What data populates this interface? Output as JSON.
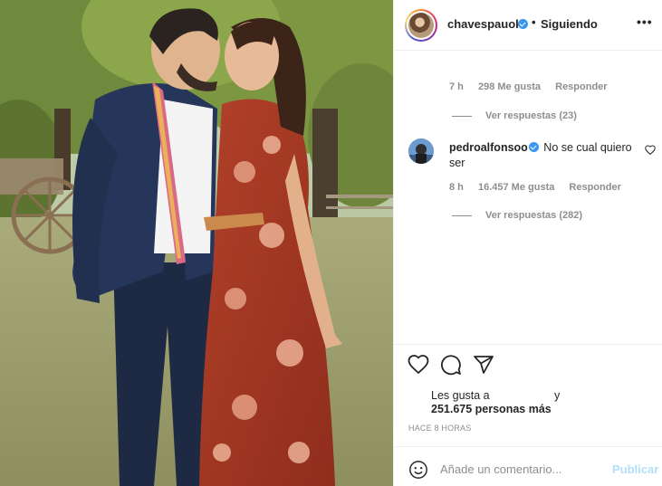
{
  "post": {
    "image_alt": "",
    "username": "chavespauok",
    "separator": "•",
    "follow_status": "Siguiendo",
    "more_options": "•••"
  },
  "comments": [
    {
      "time": "7 h",
      "likes": "298 Me gusta",
      "reply": "Responder",
      "view_replies": "Ver respuestas (23)"
    },
    {
      "username": "pedroalfonsoo",
      "text": "No se cual quiero ser",
      "time": "8 h",
      "likes": "16.457 Me gusta",
      "reply": "Responder",
      "view_replies": "Ver respuestas (282)"
    }
  ],
  "likes": {
    "prefix": "Les gusta a",
    "conjunction": "y",
    "count_text": "251.675 personas más"
  },
  "timestamp": "HACE 8 HORAS",
  "comment_input": {
    "placeholder": "Añade un comentario...",
    "publish_label": "Publicar"
  },
  "icons": {
    "like": "heart-icon",
    "comment": "comment-icon",
    "share": "paper-plane-icon",
    "emoji": "emoji-icon",
    "verified": "verified-badge-icon"
  },
  "colors": {
    "verified": "#3897f0",
    "publish_disabled": "#b2dffc",
    "meta_text": "#8e8e8e"
  }
}
